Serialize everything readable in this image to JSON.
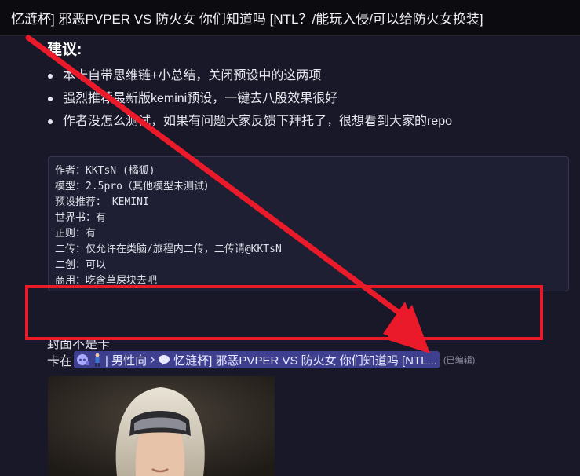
{
  "header": {
    "title": "忆涟杯] 邪恶PVPER VS 防火女 你们知道吗 [NTL？/能玩入侵/可以给防火女换装]"
  },
  "suggestions": {
    "heading": "建议:",
    "items": [
      "本卡自带思维链+小总结，关闭预设中的这两项",
      "强烈推荐最新版kemini预设，一键去八股效果很好",
      "作者没怎么测试，如果有问题大家反馈下拜托了，很想看到大家的repo"
    ]
  },
  "info_block": {
    "lines": [
      "作者：KKTsN (橘狐)",
      "模型：2.5pro（其他模型未测试）",
      "预设推荐： KEMINI",
      "世界书：有",
      "正则：有",
      "二传：仅允许在类脑/旅程内二传，二传请@KKTsN",
      "二创：可以",
      "商用：吃含草屎块去吧"
    ]
  },
  "cover_note": "封面不是卡",
  "card_link": {
    "prefix": "卡在",
    "category": "| 男性向",
    "thread": "忆涟杯] 邪恶PVPER VS 防火女 你们知道吗 [NTL...",
    "edited": "(已编辑)"
  },
  "colors": {
    "background": "#181828",
    "mention_bg": "#3e3f8f",
    "annotation_red": "#ea1a2a"
  },
  "icons": [
    "discord-icon",
    "figure-icon",
    "chevron-right-icon",
    "thread-icon"
  ]
}
